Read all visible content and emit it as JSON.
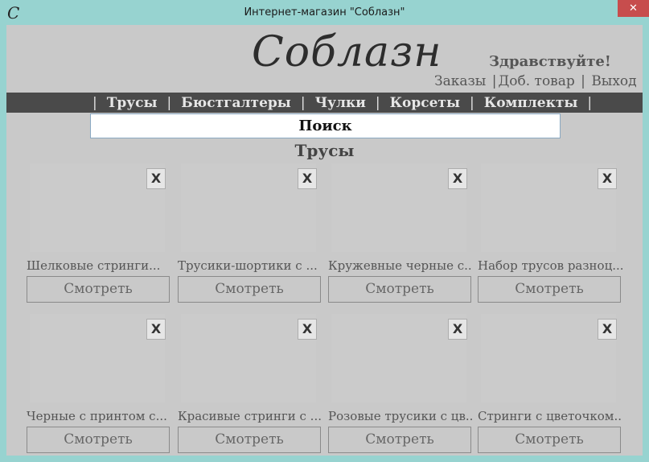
{
  "window": {
    "title": "Интернет-магазин \"Соблазн\"",
    "icon_glyph": "C",
    "close_glyph": "✕"
  },
  "header": {
    "logo": "Соблазн",
    "greeting": "Здравствуйте!",
    "links": {
      "orders": "Заказы",
      "add_product": "Доб. товар",
      "logout": "Выход",
      "separator": "|"
    }
  },
  "nav": {
    "separator": "|",
    "items": [
      "Трусы",
      "Бюстгалтеры",
      "Чулки",
      "Корсеты",
      "Комплекты"
    ]
  },
  "search": {
    "value": "Поиск"
  },
  "section": {
    "title": "Трусы"
  },
  "products": [
    {
      "name": "Шелковые стринги...",
      "button": "Смотреть",
      "delete": "X"
    },
    {
      "name": "Трусики-шортики с ...",
      "button": "Смотреть",
      "delete": "X"
    },
    {
      "name": "Кружевные черные с...",
      "button": "Смотреть",
      "delete": "X"
    },
    {
      "name": "Набор трусов разноц...",
      "button": "Смотреть",
      "delete": "X"
    },
    {
      "name": "Черные с принтом  с...",
      "button": "Смотреть",
      "delete": "X"
    },
    {
      "name": "Красивые стринги с ...",
      "button": "Смотреть",
      "delete": "X"
    },
    {
      "name": "Розовые трусики с цв...",
      "button": "Смотреть",
      "delete": "X"
    },
    {
      "name": "Стринги с цветочком...",
      "button": "Смотреть",
      "delete": "X"
    }
  ],
  "colors": {
    "window_frame": "#97d3d0",
    "client_bg": "#c9c9c9",
    "navbar_bg": "#4a4a4a",
    "close_button": "#c74d4d"
  }
}
